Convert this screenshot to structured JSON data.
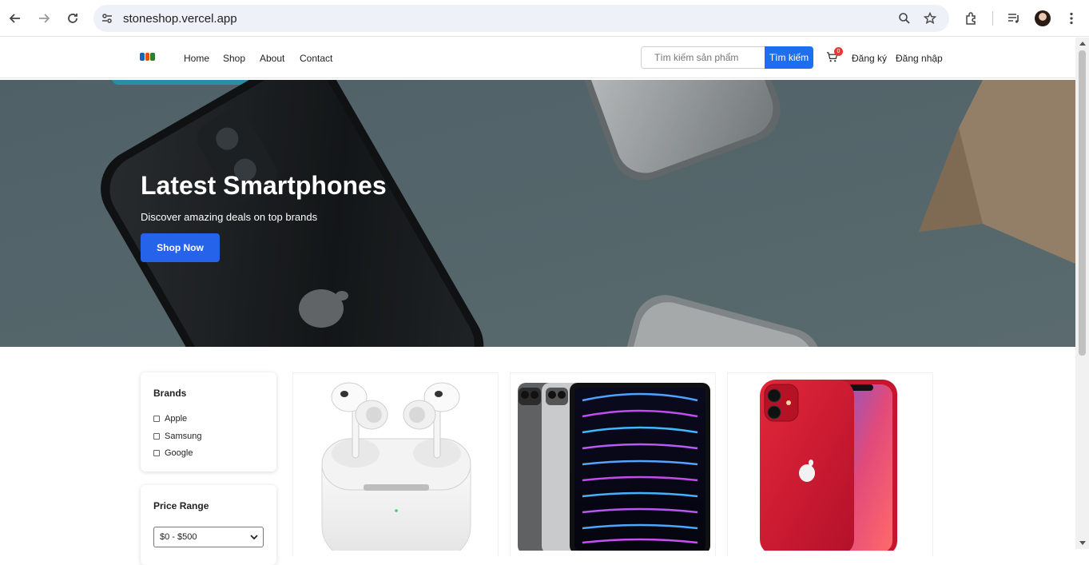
{
  "browser": {
    "url": "stoneshop.vercel.app"
  },
  "header": {
    "nav": [
      "Home",
      "Shop",
      "About",
      "Contact"
    ],
    "search_placeholder": "Tìm kiếm sản phẩm",
    "search_button": "Tìm kiếm",
    "cart_count": "0",
    "register": "Đăng ký",
    "login": "Đăng nhập",
    "accent_color": "#1e6ef0"
  },
  "hero": {
    "title": "Latest Smartphones",
    "subtitle": "Discover amazing deals on top brands",
    "cta": "Shop Now"
  },
  "filters": {
    "brands_title": "Brands",
    "brands": [
      "Apple",
      "Samsung",
      "Google"
    ],
    "price_title": "Price Range",
    "price_selected": "$0 - $500"
  },
  "products": [
    {
      "image": "airpods-pro-image"
    },
    {
      "image": "ipad-pro-image"
    },
    {
      "image": "iphone-11-red-image"
    }
  ]
}
